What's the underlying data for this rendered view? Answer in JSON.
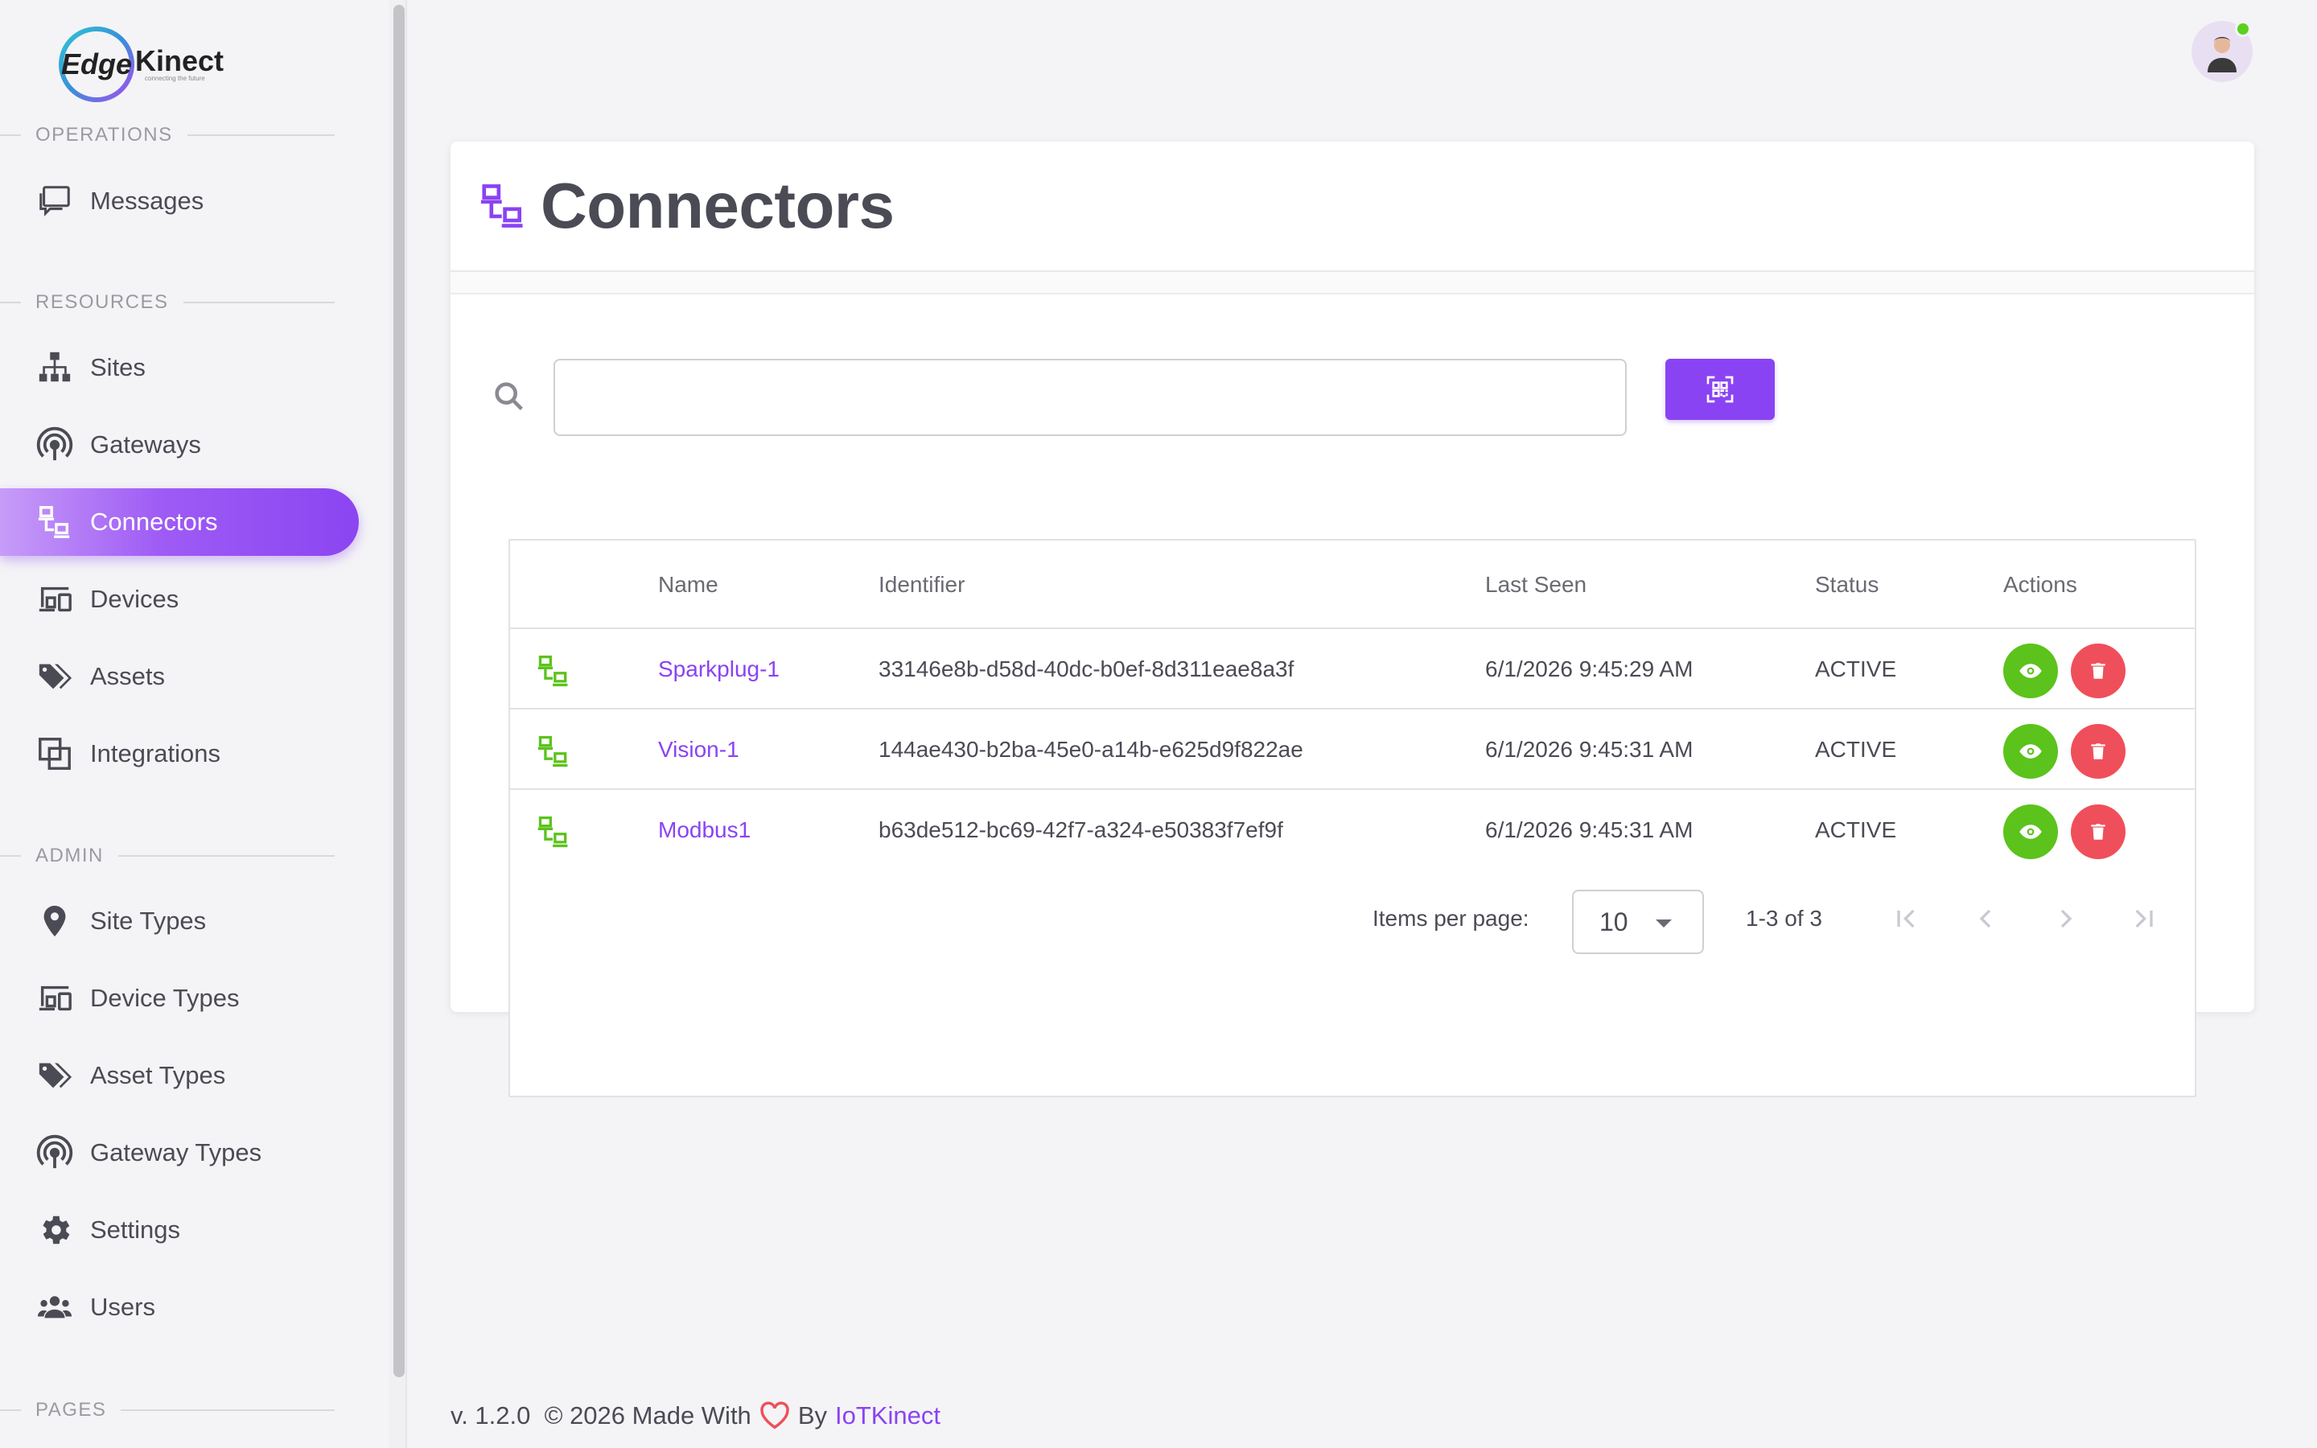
{
  "brand": {
    "logo_left": "Edge",
    "logo_right": "Kinect",
    "logo_tagline": "connecting the future"
  },
  "sidebar": {
    "sections": [
      {
        "title": "OPERATIONS"
      },
      {
        "title": "RESOURCES"
      },
      {
        "title": "ADMIN"
      },
      {
        "title": "PAGES"
      }
    ],
    "items": [
      {
        "label": "Messages",
        "icon": "messages-icon"
      },
      {
        "label": "Sites",
        "icon": "sitemap-icon"
      },
      {
        "label": "Gateways",
        "icon": "gateway-icon"
      },
      {
        "label": "Connectors",
        "icon": "connector-icon",
        "active": true
      },
      {
        "label": "Devices",
        "icon": "devices-icon"
      },
      {
        "label": "Assets",
        "icon": "tags-icon"
      },
      {
        "label": "Integrations",
        "icon": "integrations-icon"
      },
      {
        "label": "Site Types",
        "icon": "location-icon"
      },
      {
        "label": "Device Types",
        "icon": "devices-icon"
      },
      {
        "label": "Asset Types",
        "icon": "tags-icon"
      },
      {
        "label": "Gateway Types",
        "icon": "gateway-icon"
      },
      {
        "label": "Settings",
        "icon": "gear-icon"
      },
      {
        "label": "Users",
        "icon": "users-icon"
      }
    ]
  },
  "page": {
    "title": "Connectors"
  },
  "search": {
    "value": "",
    "placeholder": ""
  },
  "table": {
    "columns": [
      "Name",
      "Identifier",
      "Last Seen",
      "Status",
      "Actions"
    ],
    "rows": [
      {
        "name": "Sparkplug-1",
        "identifier": "33146e8b-d58d-40dc-b0ef-8d311eae8a3f",
        "last_seen": "6/1/2026 9:45:29 AM",
        "status": "ACTIVE"
      },
      {
        "name": "Vision-1",
        "identifier": "144ae430-b2ba-45e0-a14b-e625d9f822ae",
        "last_seen": "6/1/2026 9:45:31 AM",
        "status": "ACTIVE"
      },
      {
        "name": "Modbus1",
        "identifier": "b63de512-bc69-42f7-a324-e50383f7ef9f",
        "last_seen": "6/1/2026 9:45:31 AM",
        "status": "ACTIVE"
      }
    ]
  },
  "pager": {
    "label": "Items per page:",
    "page_size": "10",
    "range": "1-3 of 3"
  },
  "footer": {
    "version": "v. 1.2.0",
    "copy": "© 2026 Made With",
    "by": "By",
    "brand": "IoTKinect"
  },
  "colors": {
    "accent": "#8a43f3",
    "success": "#5bc31b",
    "danger": "#ef4f5b",
    "online": "#5bd11d"
  }
}
